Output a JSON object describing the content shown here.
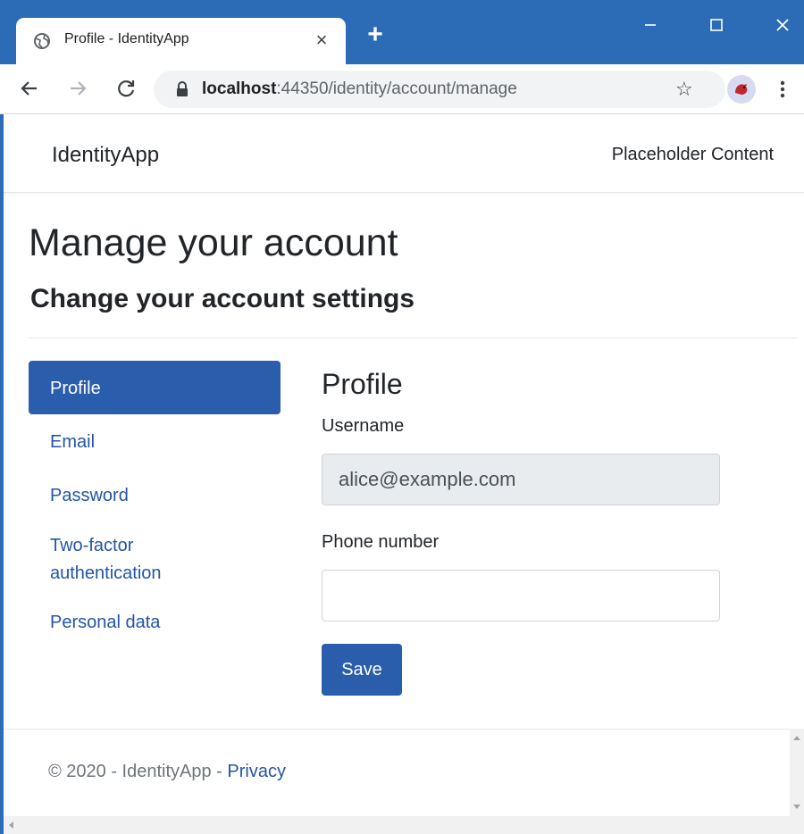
{
  "browser": {
    "tab_title": "Profile - IdentityApp",
    "url_host": "localhost",
    "url_path": ":44350/identity/account/manage",
    "accent_color": "#2c6cb7"
  },
  "app": {
    "brand": "IdentityApp",
    "nav_link": "Placeholder Content"
  },
  "page": {
    "title": "Manage your account",
    "subtitle": "Change your account settings"
  },
  "sidebar": {
    "items": [
      {
        "label": "Profile",
        "active": true
      },
      {
        "label": "Email",
        "active": false
      },
      {
        "label": "Password",
        "active": false
      },
      {
        "label": "Two-factor authentication",
        "active": false
      },
      {
        "label": "Personal data",
        "active": false
      }
    ]
  },
  "profile": {
    "heading": "Profile",
    "username_label": "Username",
    "username_value": "alice@example.com",
    "phone_label": "Phone number",
    "phone_value": "",
    "save_label": "Save"
  },
  "footer": {
    "text": "© 2020 - IdentityApp - ",
    "privacy_link": "Privacy"
  }
}
